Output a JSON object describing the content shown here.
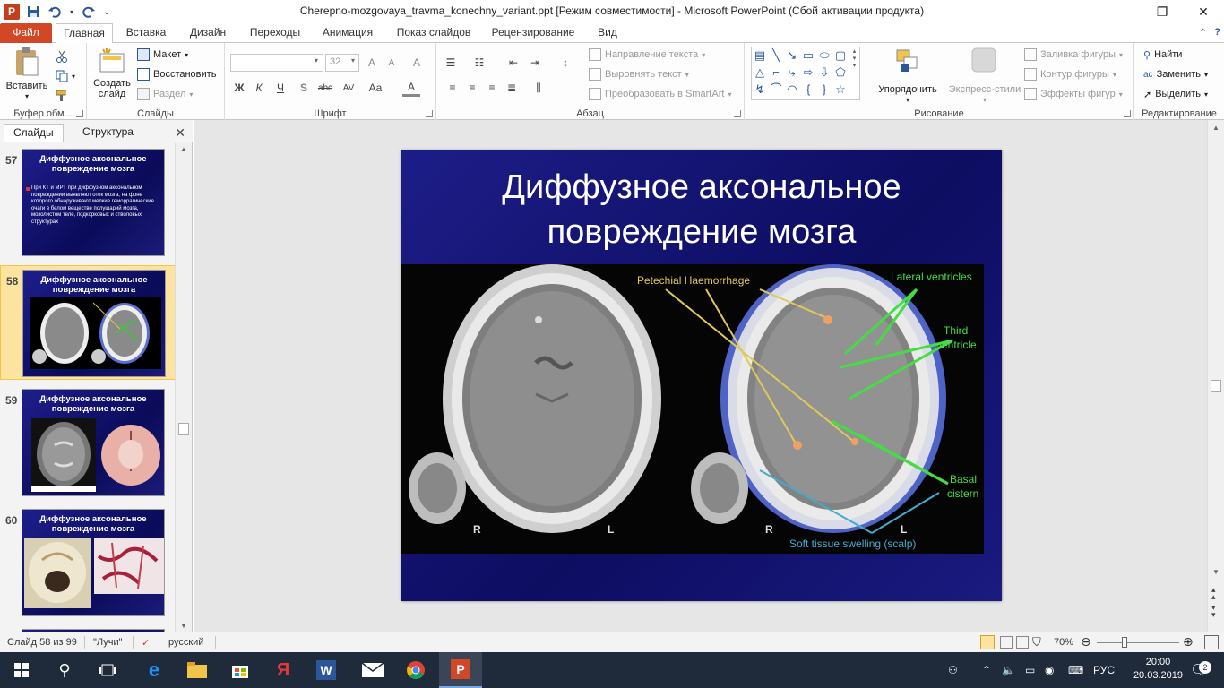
{
  "window": {
    "title": "Cherepno-mozgovaya_travma_konechny_variant.ppt [Режим совместимости]  -  Microsoft PowerPoint (Сбой активации продукта)",
    "app_logo": "P"
  },
  "tabs": {
    "file": "Файл",
    "items": [
      "Главная",
      "Вставка",
      "Дизайн",
      "Переходы",
      "Анимация",
      "Показ слайдов",
      "Рецензирование",
      "Вид"
    ]
  },
  "ribbon": {
    "clipboard": {
      "label": "Буфер обм...",
      "paste": "Вставить"
    },
    "slides": {
      "label": "Слайды",
      "new_slide_1": "Создать",
      "new_slide_2": "слайд",
      "layout": "Макет",
      "reset": "Восстановить",
      "section": "Раздел"
    },
    "font": {
      "label": "Шрифт",
      "font_name": "",
      "font_size": "32",
      "bold": "Ж",
      "italic": "К",
      "underline": "Ч",
      "strike": "abc",
      "shadow": "S",
      "spacing": "AV",
      "case": "Aa",
      "grow": "A",
      "shrink": "A",
      "clear": "A",
      "color": "A"
    },
    "paragraph": {
      "label": "Абзац",
      "text_direction": "Направление текста",
      "align_text": "Выровнять текст",
      "smartart": "Преобразовать в SmartArt"
    },
    "drawing": {
      "label": "Рисование",
      "arrange": "Упорядочить",
      "quick_styles": "Экспресс-стили",
      "fill": "Заливка фигуры",
      "outline": "Контур фигуры",
      "effects": "Эффекты фигур"
    },
    "editing": {
      "label": "Редактирование",
      "find": "Найти",
      "replace": "Заменить",
      "select": "Выделить"
    }
  },
  "left_pane": {
    "tab_slides": "Слайды",
    "tab_outline": "Структура",
    "thumbs": [
      {
        "num": "57",
        "title": "Диффузное аксональное повреждение мозга",
        "text": "При КТ и МРТ при диффузном аксональном повреждении выявляют отек мозга, на фоне которого обнаруживают мелкие геморрагические очаги в белом веществе полушарий мозга, мозолистом теле, подкорковых и стволовых структурах"
      },
      {
        "num": "58",
        "title": "Диффузное аксональное повреждение мозга"
      },
      {
        "num": "59",
        "title": "Диффузное аксональное повреждение мозга"
      },
      {
        "num": "60",
        "title": "Диффузное аксональное повреждение мозга"
      }
    ]
  },
  "slide": {
    "title": "Диффузное аксональное повреждение мозга",
    "image_labels": {
      "petechial": "Petechial Haemorrhage",
      "lateral": "Lateral ventricles",
      "third_1": "Third",
      "third_2": "ventricle",
      "basal_1": "Basal",
      "basal_2": "cistern",
      "scalp": "Soft tissue swelling (scalp)",
      "r": "R",
      "l": "L"
    }
  },
  "statusbar": {
    "slide_info": "Слайд 58 из 99",
    "theme": "\"Лучи\"",
    "language": "русский",
    "zoom": "70%"
  },
  "taskbar": {
    "lang": "РУС",
    "time": "20:00",
    "date": "20.03.2019",
    "notifications": "2"
  },
  "colors": {
    "file_tab": "#d24726",
    "slide_bg": "#0d0d62",
    "accent": "#2b579a",
    "taskbar": "#1f2a3a"
  }
}
